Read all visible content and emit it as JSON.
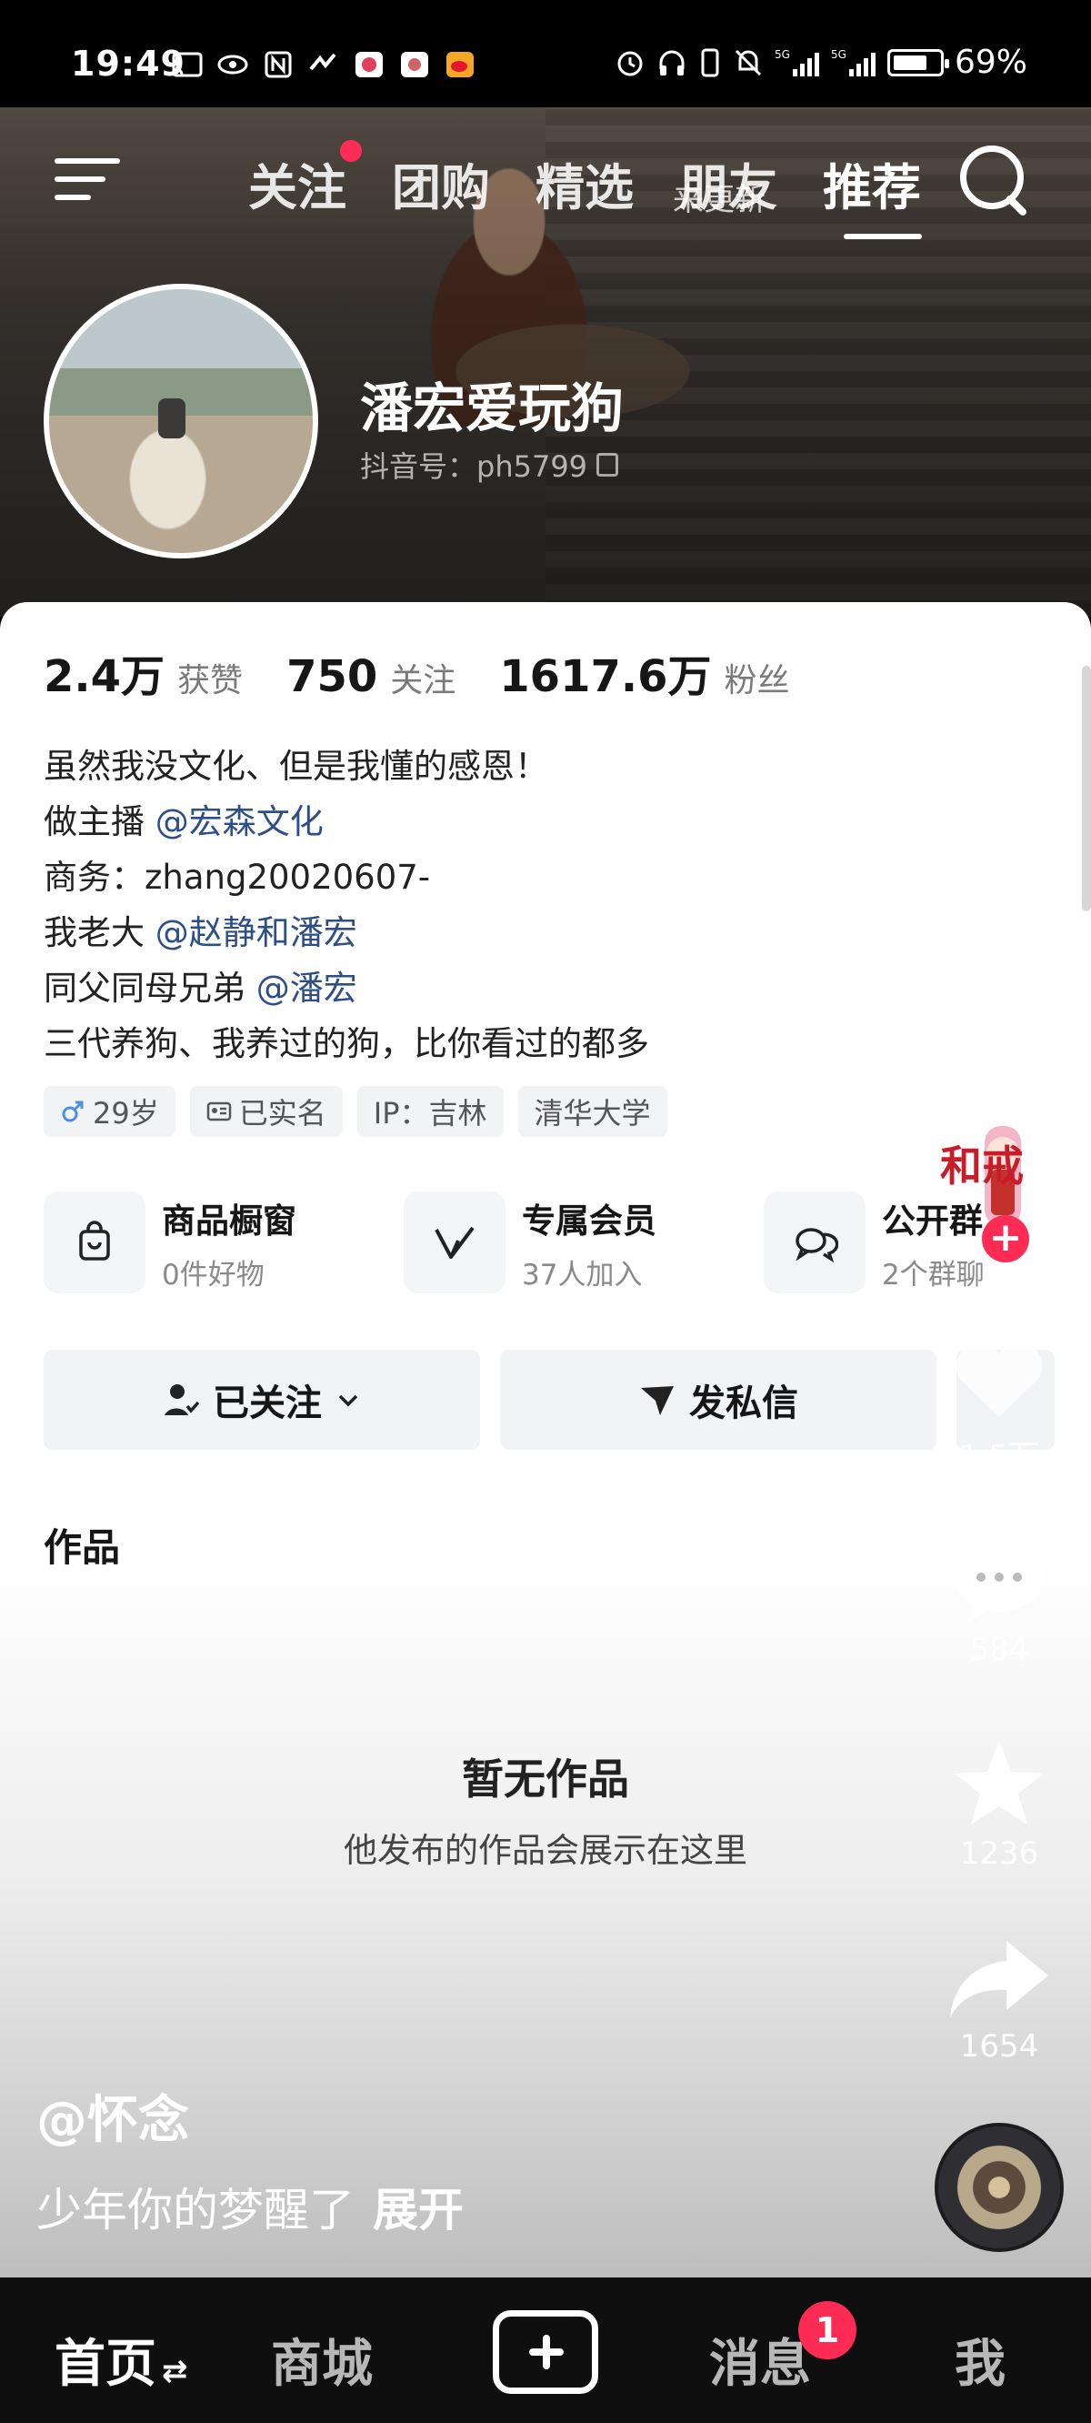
{
  "status_bar": {
    "time": "19:49",
    "battery": "69%",
    "icons_left": [
      "cast-icon",
      "eye-icon",
      "nfc-icon",
      "wave-icon",
      "app-icon",
      "app-icon",
      "weibo-icon"
    ],
    "icons_right": [
      "alarm-icon",
      "headphones-icon",
      "vibrate-icon",
      "mute-icon",
      "signal-5g-icon",
      "signal-5g-icon",
      "battery-icon"
    ]
  },
  "top_nav": {
    "tabs": [
      "关注",
      "团购",
      "精选",
      "朋友",
      "推荐"
    ],
    "active_tab": "推荐",
    "update_hint": "来更新"
  },
  "profile": {
    "nickname": "潘宏爱玩狗",
    "douyin_id": "抖音号：ph5799",
    "stats": [
      {
        "value": "2.4万",
        "label": "获赞"
      },
      {
        "value": "750",
        "label": "关注"
      },
      {
        "value": "1617.6万",
        "label": "粉丝"
      }
    ],
    "bio": {
      "line1": "虽然我没文化、但是我懂的感恩！",
      "line2_prefix": "做主播 ",
      "line2_mention": "@宏森文化",
      "line3": "商务：zhang20020607-",
      "line4_prefix": "我老大 ",
      "line4_mention": "@赵静和潘宏",
      "line5_prefix": "同父同母兄弟 ",
      "line5_mention": "@潘宏",
      "line6": "三代养狗、我养过的狗，比你看过的都多"
    },
    "tags": {
      "age": "29岁",
      "verified": "已实名",
      "ip": "IP：吉林",
      "school": "清华大学"
    },
    "features": [
      {
        "title": "商品橱窗",
        "sub": "0件好物"
      },
      {
        "title": "专属会员",
        "sub": "37人加入"
      },
      {
        "title": "公开群",
        "sub": "2个群聊"
      }
    ],
    "buttons": {
      "followed": "已关注",
      "message": "发私信"
    },
    "works_title": "作品",
    "empty_title": "暂无作品",
    "empty_sub": "他发布的作品会展示在这里"
  },
  "rail": {
    "likes": "1.5万",
    "comments": "584",
    "favorites": "1236",
    "shares": "1654",
    "follow_badge_text": "和戒"
  },
  "video": {
    "author": "@怀念",
    "caption": "少年你的梦醒了",
    "expand": "展开"
  },
  "bottom_nav": {
    "home": "首页",
    "mall": "商城",
    "messages": "消息",
    "messages_badge": "1",
    "me": "我"
  },
  "colors": {
    "accent_red": "#fe2c55",
    "mention_blue": "#2d4f86"
  }
}
